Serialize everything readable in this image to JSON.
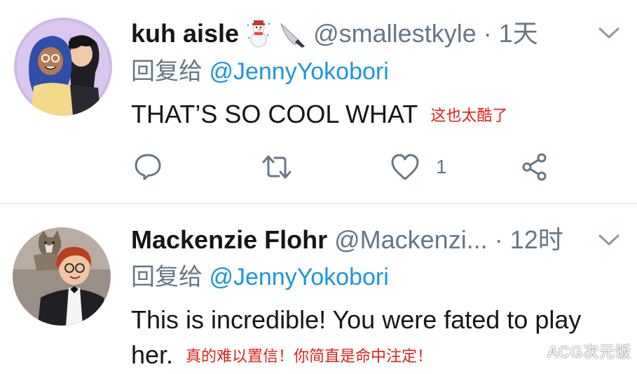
{
  "tweets": [
    {
      "display_name": "kuh aisle",
      "emoji_icons": [
        "snowman-icon",
        "knife-icon"
      ],
      "handle": "@smallestkyle",
      "separator": "·",
      "time": "1天",
      "reply_prefix": "回复给",
      "reply_to": "@JennyYokobori",
      "text": "THAT’S SO COOL WHAT",
      "annotation": "这也太酷了",
      "like_count": "1"
    },
    {
      "display_name": "Mackenzie Flohr",
      "handle": "@Mackenzi...",
      "separator": "·",
      "time": "12时",
      "reply_prefix": "回复给",
      "reply_to": "@JennyYokobori",
      "text": "This is incredible! You were fated to play her.",
      "annotation": "真的难以置信！你简直是命中注定！"
    }
  ],
  "watermark": "ACG次元饭",
  "colors": {
    "accent": "#1b95e0",
    "secondary_text": "#657786",
    "annotation": "#e0201b",
    "divider": "#e6ecf0"
  }
}
